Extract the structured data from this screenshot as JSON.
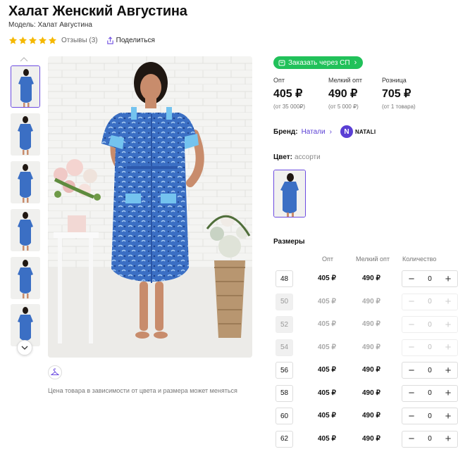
{
  "product": {
    "title": "Халат Женский Августина",
    "model": "Модель: Халат Августина",
    "reviews": "Отзывы (3)",
    "share": "Поделиться"
  },
  "price_note": "Цена товара в зависимости от цвета и размера может меняться",
  "sp_button": "Заказать через СП",
  "prices": [
    {
      "label": "Опт",
      "value": "405 ₽",
      "sub": "(от 35 000₽)"
    },
    {
      "label": "Мелкий опт",
      "value": "490 ₽",
      "sub": "(от 5 000 ₽)"
    },
    {
      "label": "Розница",
      "value": "705 ₽",
      "sub": "(от 1 товара)"
    }
  ],
  "brand": {
    "label": "Бренд:",
    "name": "Натали",
    "logo_letter": "N",
    "logo_text": "NATALI"
  },
  "color": {
    "label": "Цвет:",
    "value": "ассорти"
  },
  "sizes": {
    "title": "Размеры",
    "col_opt": "Опт",
    "col_small": "Мелкий опт",
    "col_qty": "Количество",
    "rows": [
      {
        "size": "48",
        "opt": "405 ₽",
        "small": "490 ₽",
        "qty": "0",
        "enabled": true
      },
      {
        "size": "50",
        "opt": "405 ₽",
        "small": "490 ₽",
        "qty": "0",
        "enabled": false
      },
      {
        "size": "52",
        "opt": "405 ₽",
        "small": "490 ₽",
        "qty": "0",
        "enabled": false
      },
      {
        "size": "54",
        "opt": "405 ₽",
        "small": "490 ₽",
        "qty": "0",
        "enabled": false
      },
      {
        "size": "56",
        "opt": "405 ₽",
        "small": "490 ₽",
        "qty": "0",
        "enabled": true
      },
      {
        "size": "58",
        "opt": "405 ₽",
        "small": "490 ₽",
        "qty": "0",
        "enabled": true
      },
      {
        "size": "60",
        "opt": "405 ₽",
        "small": "490 ₽",
        "qty": "0",
        "enabled": true
      },
      {
        "size": "62",
        "opt": "405 ₽",
        "small": "490 ₽",
        "qty": "0",
        "enabled": true
      }
    ]
  },
  "stepper": {
    "minus": "−",
    "plus": "+"
  },
  "icons": {
    "star": "star-icon",
    "share": "share-icon",
    "cart": "cart-icon",
    "hanger": "hanger-icon",
    "chevron_up": "chevron-up-icon",
    "chevron_down": "chevron-down-icon"
  },
  "colors": {
    "accent": "#6c4be0",
    "brand_link": "#5a3fd4",
    "sp_green": "#21c15a",
    "star": "#f5b800",
    "dress": "#3b6fc4"
  },
  "rating": 5
}
